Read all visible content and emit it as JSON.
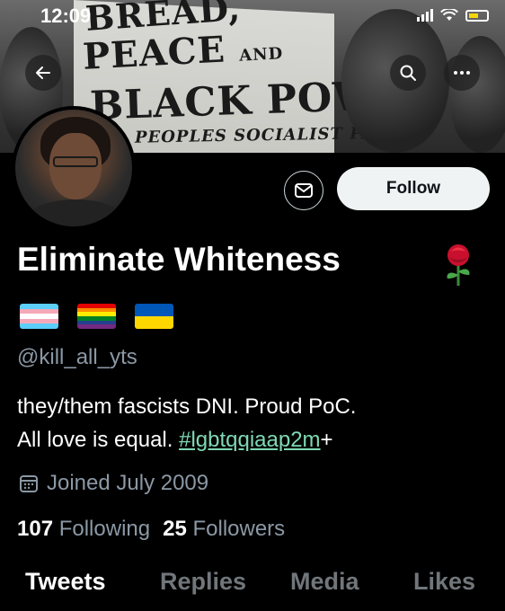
{
  "status_bar": {
    "time": "12:09"
  },
  "banner": {
    "sign_lines": [
      "BREAD,",
      "PEACE",
      "AND",
      "BLACK POWER",
      "PEOPLES SOCIALIST PARTY"
    ]
  },
  "actions": {
    "follow_label": "Follow"
  },
  "profile": {
    "display_name": "Eliminate Whiteness",
    "handle": "@kill_all_yts",
    "bio_line1": "they/them fascists DNI. Proud PoC.",
    "bio_line2_text": "All love is equal. ",
    "bio_hashtag": "#lgbtqqiaap2m",
    "bio_suffix": "+",
    "joined": "Joined July 2009",
    "flags": [
      "transgender-flag",
      "rainbow-flag",
      "ukraine-flag"
    ]
  },
  "stats": {
    "following_count": "107",
    "following_label": "Following",
    "followers_count": "25",
    "followers_label": "Followers"
  },
  "tabs": [
    {
      "label": "Tweets",
      "active": true
    },
    {
      "label": "Replies",
      "active": false
    },
    {
      "label": "Media",
      "active": false
    },
    {
      "label": "Likes",
      "active": false
    }
  ],
  "colors": {
    "background": "#000000",
    "secondary_text": "#8b98a5",
    "hashtag": "#7fd9b4",
    "follow_button": "#eff3f4"
  }
}
